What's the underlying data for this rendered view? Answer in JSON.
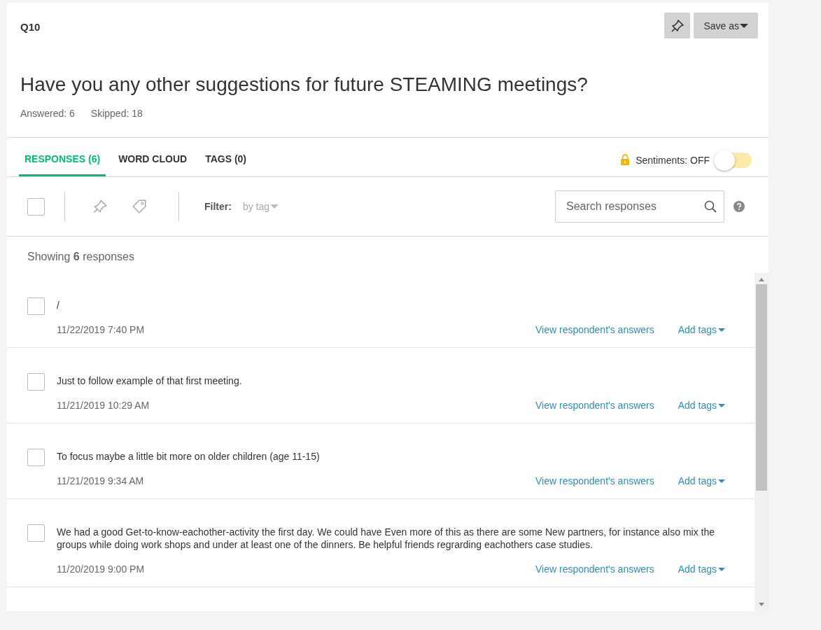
{
  "question": {
    "number": "Q10",
    "title": "Have you any other suggestions for future STEAMING meetings?",
    "answered": "Answered: 6",
    "skipped": "Skipped: 18"
  },
  "save_button": "Save as",
  "tabs": [
    {
      "label": "RESPONSES (6)",
      "selected": true
    },
    {
      "label": "WORD CLOUD",
      "selected": false
    },
    {
      "label": "TAGS (0)",
      "selected": false
    }
  ],
  "sentiments": {
    "label": "Sentiments: OFF",
    "on": false
  },
  "toolbar": {
    "select_all_checked": false,
    "filter_label": "Filter:",
    "filter_value": "by tag",
    "search_placeholder": "Search responses"
  },
  "showing": "Showing **6** responses",
  "responses": [
    {
      "text": "/",
      "date": "11/22/2019 7:40 PM",
      "checked": false,
      "view_link": "View respondent's answers",
      "tags_link": "Add tags"
    },
    {
      "text": "Just to follow example of that first meeting.",
      "date": "11/21/2019 10:29 AM",
      "checked": false,
      "view_link": "View respondent's answers",
      "tags_link": "Add tags"
    },
    {
      "text": "To focus maybe a little bit more on older children (age 11-15)",
      "date": "11/21/2019 9:34 AM",
      "checked": false,
      "view_link": "View respondent's answers",
      "tags_link": "Add tags"
    },
    {
      "text": "We had a good Get-to-know-eachother-activity the first day. We could have Even more of this as there are some New partners, for instance also mix the groups while doing work shops and under at least one of the dinners. Be helpful friends regrarding eachothers case studies.",
      "date": "11/20/2019 9:00 PM",
      "checked": false,
      "view_link": "View respondent's answers",
      "tags_link": "Add tags"
    }
  ]
}
